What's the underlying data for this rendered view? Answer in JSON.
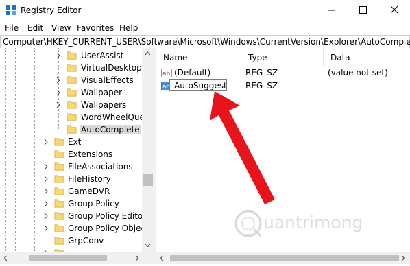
{
  "window": {
    "title": "Registry Editor"
  },
  "menu": [
    {
      "label": "File",
      "accel": "F",
      "rest": "ile"
    },
    {
      "label": "Edit",
      "accel": "E",
      "rest": "dit"
    },
    {
      "label": "View",
      "accel": "V",
      "rest": "iew"
    },
    {
      "label": "Favorites",
      "accel": "F",
      "rest": "avorites"
    },
    {
      "label": "Help",
      "accel": "H",
      "rest": "elp"
    }
  ],
  "address": "Computer\\HKEY_CURRENT_USER\\Software\\Microsoft\\Windows\\CurrentVersion\\Explorer\\AutoComplete",
  "tree": {
    "items": [
      {
        "label": "UserAssist"
      },
      {
        "label": "VirtualDesktops"
      },
      {
        "label": "VisualEffects"
      },
      {
        "label": "Wallpaper"
      },
      {
        "label": "Wallpapers"
      },
      {
        "label": "WordWheelQuer"
      },
      {
        "label": "AutoComplete"
      },
      {
        "label": "Ext"
      },
      {
        "label": "Extensions"
      },
      {
        "label": "FileAssociations"
      },
      {
        "label": "FileHistory"
      },
      {
        "label": "GameDVR"
      },
      {
        "label": "Group Policy"
      },
      {
        "label": "Group Policy Editor"
      },
      {
        "label": "Group Policy Objects"
      },
      {
        "label": "GrpConv"
      }
    ]
  },
  "values": {
    "columns": [
      "Name",
      "Type",
      "Data"
    ],
    "rows": [
      {
        "name": "(Default)",
        "type": "REG_SZ",
        "data": "(value not set)"
      },
      {
        "name": "AutoSuggest",
        "type": "REG_SZ",
        "data": ""
      }
    ]
  },
  "watermark": "uantrimong",
  "colors": {
    "arrow": "#e8141b",
    "folder": "#f8d775",
    "selected": "#d9d9d9"
  }
}
